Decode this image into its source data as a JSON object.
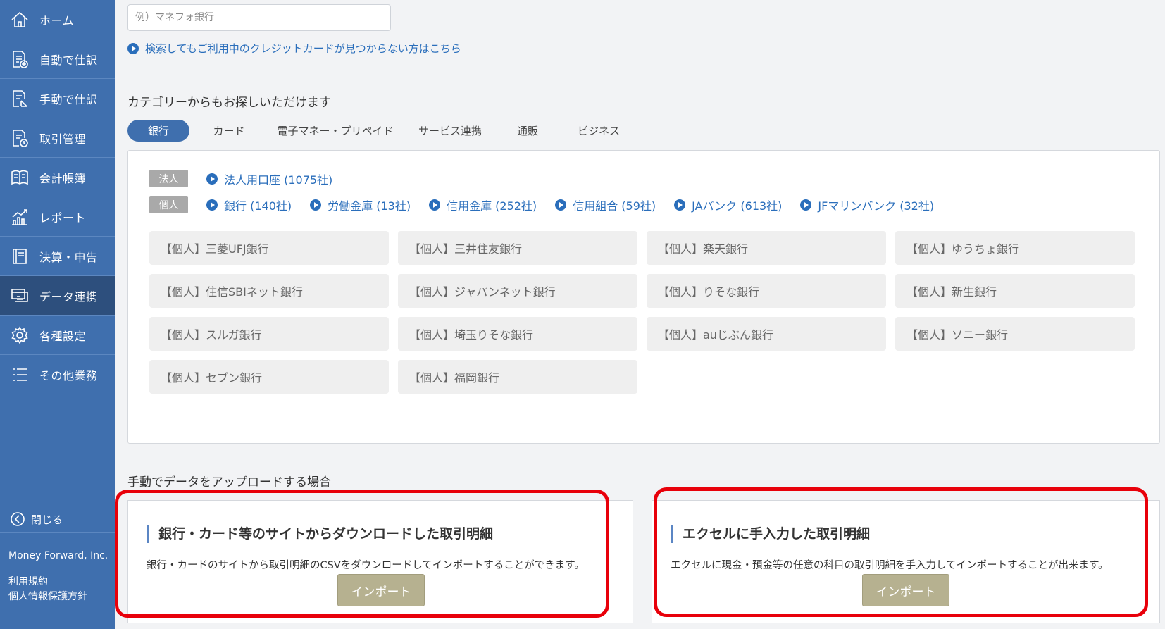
{
  "sidebar": {
    "items": [
      {
        "label": "ホーム",
        "icon": "home-icon"
      },
      {
        "label": "自動で仕訳",
        "icon": "auto-journal-icon"
      },
      {
        "label": "手動で仕訳",
        "icon": "manual-journal-icon"
      },
      {
        "label": "取引管理",
        "icon": "transaction-icon"
      },
      {
        "label": "会計帳簿",
        "icon": "ledger-icon"
      },
      {
        "label": "レポート",
        "icon": "report-icon"
      },
      {
        "label": "決算・申告",
        "icon": "tax-return-icon"
      },
      {
        "label": "データ連携",
        "icon": "data-link-icon"
      },
      {
        "label": "各種設定",
        "icon": "gear-icon"
      },
      {
        "label": "その他業務",
        "icon": "list-icon"
      }
    ],
    "active_item": "データ連携",
    "close_label": "閉じる",
    "company": "Money Forward, Inc.",
    "links": [
      "利用規約",
      "個人情報保護方針"
    ]
  },
  "search": {
    "placeholder": "例）マネフォ銀行",
    "help_link": "検索してもご利用中のクレジットカードが見つからない方はこちら"
  },
  "categories": {
    "heading": "カテゴリーからもお探しいただけます",
    "tabs": [
      "銀行",
      "カード",
      "電子マネー・プリペイド",
      "サービス連携",
      "通販",
      "ビジネス"
    ],
    "active_tab": "銀行"
  },
  "filters": {
    "corporate_badge": "法人",
    "corporate_links": [
      "法人用口座 (1075社)"
    ],
    "personal_badge": "個人",
    "personal_links": [
      "銀行 (140社)",
      "労働金庫 (13社)",
      "信用金庫 (252社)",
      "信用組合 (59社)",
      "JAバンク (613社)",
      "JFマリンバンク (32社)"
    ]
  },
  "banks": [
    "【個人】三菱UFJ銀行",
    "【個人】三井住友銀行",
    "【個人】楽天銀行",
    "【個人】ゆうちょ銀行",
    "【個人】住信SBIネット銀行",
    "【個人】ジャパンネット銀行",
    "【個人】りそな銀行",
    "【個人】新生銀行",
    "【個人】スルガ銀行",
    "【個人】埼玉りそな銀行",
    "【個人】auじぶん銀行",
    "【個人】ソニー銀行",
    "【個人】セブン銀行",
    "【個人】福岡銀行"
  ],
  "manual_upload": {
    "heading": "手動でデータをアップロードする場合",
    "cards": [
      {
        "title": "銀行・カード等のサイトからダウンロードした取引明細",
        "description": "銀行・カードのサイトから取引明細のCSVをダウンロードしてインポートすることができます。",
        "button": "インポート"
      },
      {
        "title": "エクセルに手入力した取引明細",
        "description": "エクセルに現金・預金等の任意の科目の取引明細を手入力してインポートすることが出来ます。",
        "button": "インポート"
      }
    ]
  },
  "colors": {
    "sidebar": "#3f6fae",
    "sidebar_active": "#2d4f7d",
    "link": "#2a6ebb",
    "import_button": "#b6b190",
    "highlight_outline": "#e8000a"
  }
}
